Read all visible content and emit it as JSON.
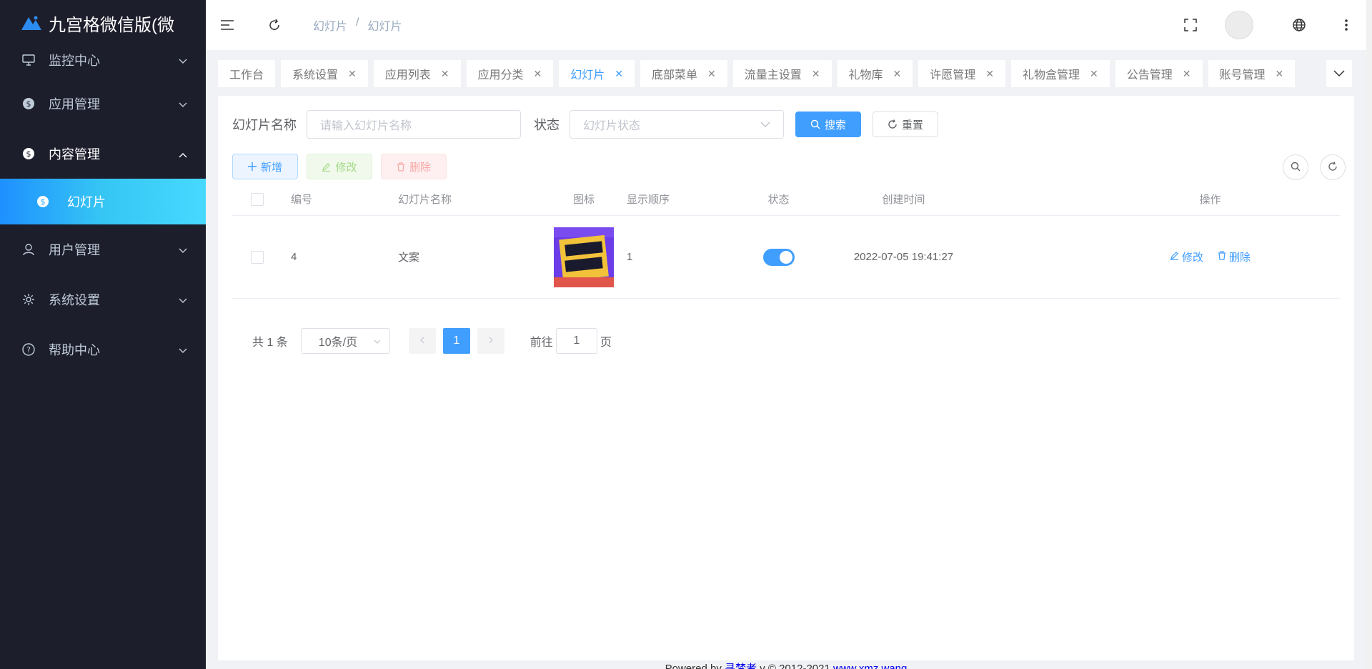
{
  "app": {
    "title": "九宫格微信版(微"
  },
  "sidebar": {
    "items": [
      {
        "label": "监控中心",
        "icon": "monitor-icon"
      },
      {
        "label": "应用管理",
        "icon": "dollar-circle-icon"
      },
      {
        "label": "内容管理",
        "icon": "dollar-circle-icon",
        "open": true
      },
      {
        "label": "用户管理",
        "icon": "user-icon"
      },
      {
        "label": "系统设置",
        "icon": "gear-icon"
      },
      {
        "label": "帮助中心",
        "icon": "question-circle-icon"
      }
    ],
    "active_sub": {
      "label": "幻灯片",
      "icon": "dollar-circle-icon"
    }
  },
  "header": {
    "breadcrumb": [
      "幻灯片",
      "幻灯片"
    ],
    "separator": "/"
  },
  "tabs": [
    {
      "label": "工作台",
      "closable": false
    },
    {
      "label": "系统设置",
      "closable": true
    },
    {
      "label": "应用列表",
      "closable": true
    },
    {
      "label": "应用分类",
      "closable": true
    },
    {
      "label": "幻灯片",
      "closable": true,
      "active": true
    },
    {
      "label": "底部菜单",
      "closable": true
    },
    {
      "label": "流量主设置",
      "closable": true
    },
    {
      "label": "礼物库",
      "closable": true
    },
    {
      "label": "许愿管理",
      "closable": true
    },
    {
      "label": "礼物盒管理",
      "closable": true
    },
    {
      "label": "公告管理",
      "closable": true
    },
    {
      "label": "账号管理",
      "closable": true
    }
  ],
  "search": {
    "name_label": "幻灯片名称",
    "name_placeholder": "请输入幻灯片名称",
    "status_label": "状态",
    "status_placeholder": "幻灯片状态",
    "search_btn": "搜索",
    "reset_btn": "重置"
  },
  "toolbar": {
    "add": "新增",
    "edit": "修改",
    "delete": "删除"
  },
  "table": {
    "headers": [
      "编号",
      "幻灯片名称",
      "图标",
      "显示顺序",
      "状态",
      "创建时间",
      "操作"
    ],
    "rows": [
      {
        "id": "4",
        "name": "文案",
        "order": "1",
        "status_on": true,
        "created": "2022-07-05 19:41:27",
        "edit": "修改",
        "delete": "删除"
      }
    ]
  },
  "pagination": {
    "total": "共 1 条",
    "page_size": "10条/页",
    "current": "1",
    "goto_prefix": "前往",
    "goto_value": "1",
    "goto_suffix": "页"
  },
  "footer": {
    "prefix": "Powered by ",
    "brand": "寻梦者",
    "mid": " v © 2012-2021 ",
    "site": "www.xmz.wang"
  },
  "colors": {
    "primary": "#409eff",
    "sidebar_bg": "#1d1e2c",
    "active_gradient_start": "#1e90ff",
    "active_gradient_end": "#47d9ff"
  }
}
